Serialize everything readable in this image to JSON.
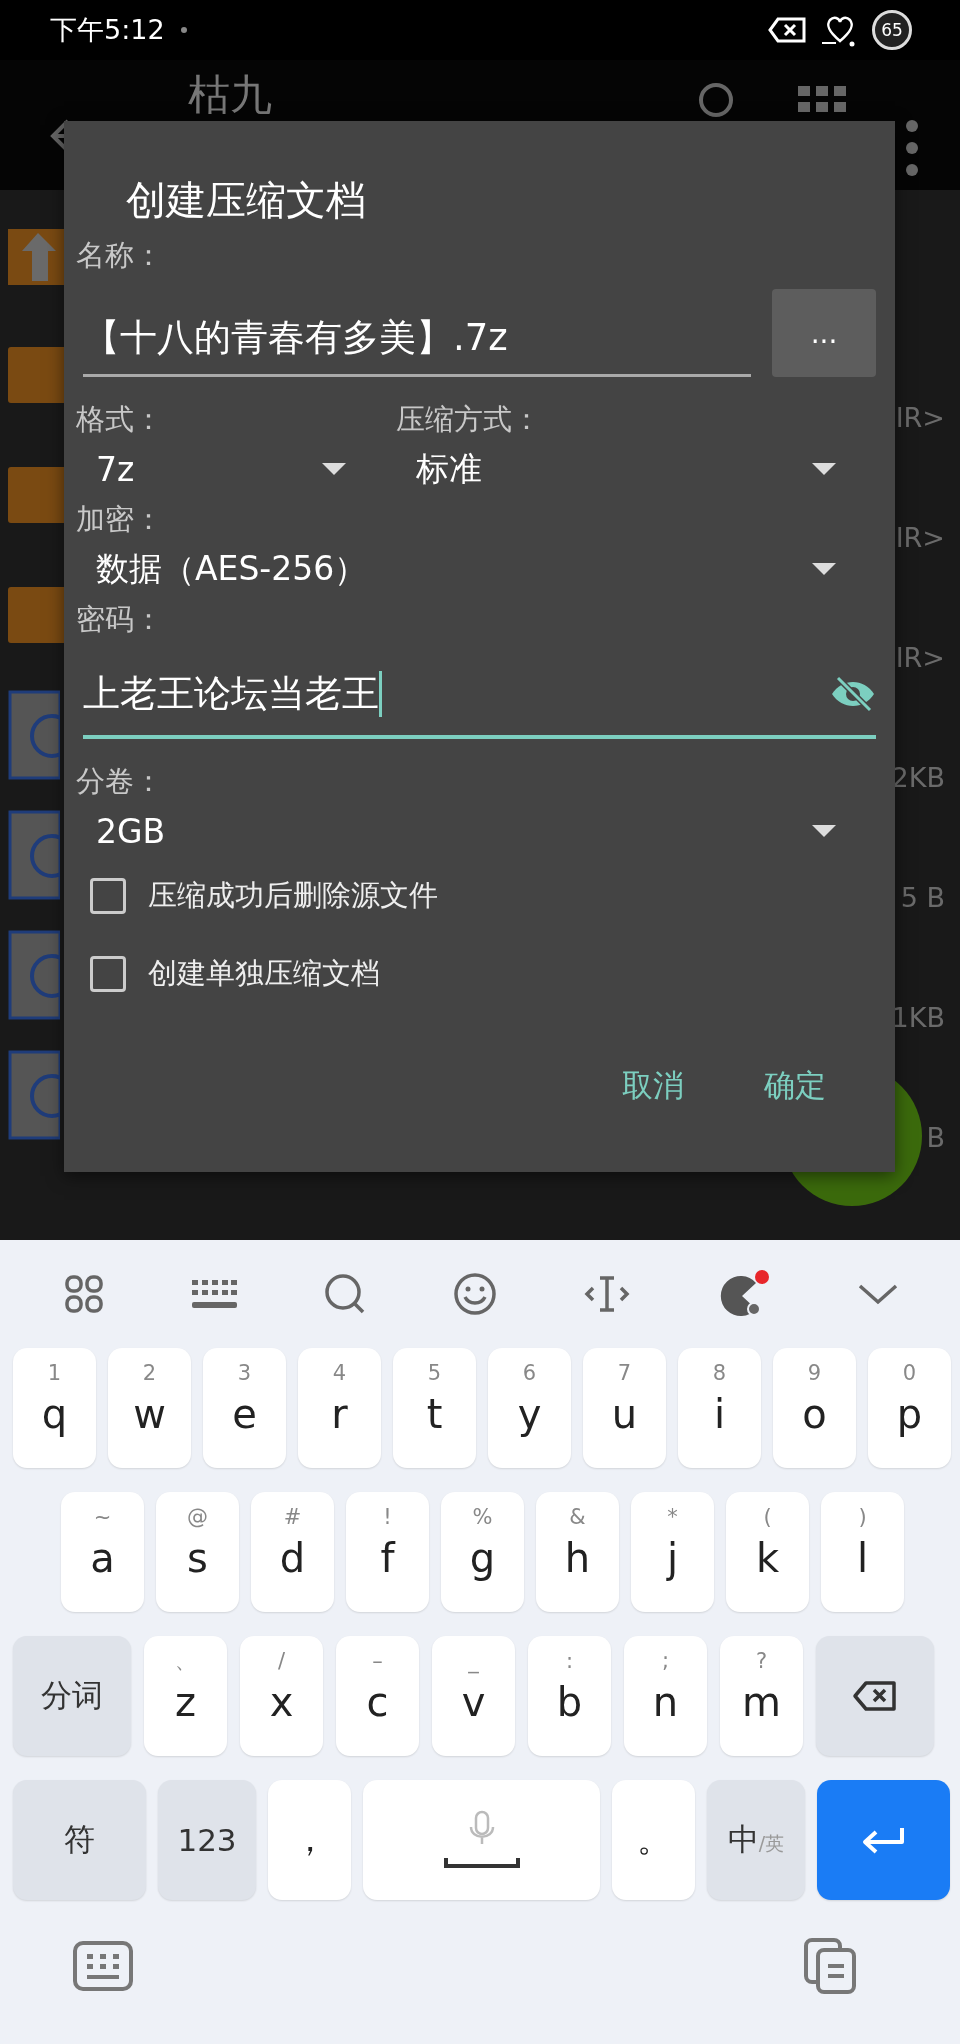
{
  "status_bar": {
    "time": "下午5:12",
    "battery": "65"
  },
  "app_bar": {
    "title": "枯九"
  },
  "file_list": {
    "rows": [
      {
        "kind": "parent",
        "size": ""
      },
      {
        "kind": "folder",
        "size": "IR>"
      },
      {
        "kind": "folder",
        "size": "IR>"
      },
      {
        "kind": "folder",
        "size": "IR>"
      },
      {
        "kind": "file",
        "size": "2KB"
      },
      {
        "kind": "file",
        "size": "5 B"
      },
      {
        "kind": "file",
        "size": "1KB"
      },
      {
        "kind": "file",
        "size": "B"
      }
    ]
  },
  "dialog": {
    "title": "创建压缩文档",
    "name_label": "名称：",
    "name_value": "【十八的青春有多美】.7z",
    "browse_button": "...",
    "format_label": "格式：",
    "format_value": "7z",
    "method_label": "压缩方式：",
    "method_value": "标准",
    "encryption_label": "加密：",
    "encryption_value": "数据（AES-256）",
    "password_label": "密码：",
    "password_value": "上老王论坛当老王",
    "split_label": "分卷：",
    "split_value": "2GB",
    "options": [
      {
        "label": "压缩成功后删除源文件",
        "checked": false
      },
      {
        "label": "创建单独压缩文档",
        "checked": false
      }
    ],
    "buttons": [
      "取消",
      "确定"
    ]
  },
  "keyboard": {
    "top_row": [
      {
        "kind": "letter",
        "label": "q",
        "hint": "1"
      },
      {
        "kind": "letter",
        "label": "w",
        "hint": "2"
      },
      {
        "kind": "letter",
        "label": "e",
        "hint": "3"
      },
      {
        "kind": "letter",
        "label": "r",
        "hint": "4"
      },
      {
        "kind": "letter",
        "label": "t",
        "hint": "5"
      },
      {
        "kind": "letter",
        "label": "y",
        "hint": "6"
      },
      {
        "kind": "letter",
        "label": "u",
        "hint": "7"
      },
      {
        "kind": "letter",
        "label": "i",
        "hint": "8"
      },
      {
        "kind": "letter",
        "label": "o",
        "hint": "9"
      },
      {
        "kind": "letter",
        "label": "p",
        "hint": "0"
      }
    ],
    "home_row": [
      {
        "kind": "letter",
        "label": "a",
        "hint": "~"
      },
      {
        "kind": "letter",
        "label": "s",
        "hint": "@"
      },
      {
        "kind": "letter",
        "label": "d",
        "hint": "#"
      },
      {
        "kind": "letter",
        "label": "f",
        "hint": "!"
      },
      {
        "kind": "letter",
        "label": "g",
        "hint": "%"
      },
      {
        "kind": "letter",
        "label": "h",
        "hint": "&"
      },
      {
        "kind": "letter",
        "label": "j",
        "hint": "*"
      },
      {
        "kind": "letter",
        "label": "k",
        "hint": "("
      },
      {
        "kind": "letter",
        "label": "l",
        "hint": ")"
      }
    ],
    "bottom_letter_row": [
      {
        "kind": "function",
        "label": "分词"
      },
      {
        "kind": "letter",
        "label": "z",
        "hint": "、"
      },
      {
        "kind": "letter",
        "label": "x",
        "hint": "/"
      },
      {
        "kind": "letter",
        "label": "c",
        "hint": "–"
      },
      {
        "kind": "letter",
        "label": "v",
        "hint": "_"
      },
      {
        "kind": "letter",
        "label": "b",
        "hint": ":"
      },
      {
        "kind": "letter",
        "label": "n",
        "hint": ";"
      },
      {
        "kind": "letter",
        "label": "m",
        "hint": "?"
      },
      {
        "kind": "backspace"
      }
    ],
    "space_row": [
      {
        "kind": "function",
        "label": "符"
      },
      {
        "kind": "function",
        "label": "123"
      },
      {
        "kind": "punct",
        "label": "，"
      },
      {
        "kind": "space"
      },
      {
        "kind": "punct",
        "label": "。"
      },
      {
        "kind": "function",
        "label": "中",
        "sub": "/英"
      },
      {
        "kind": "enter"
      }
    ]
  }
}
